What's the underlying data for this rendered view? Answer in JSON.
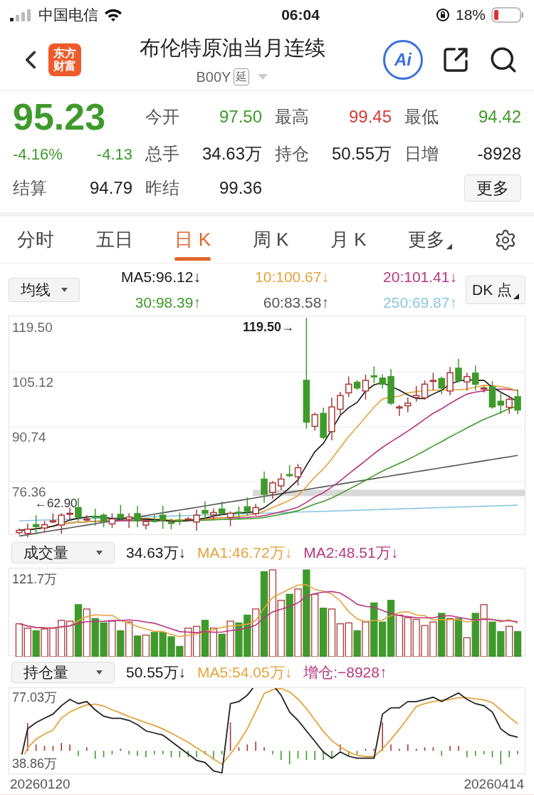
{
  "status_bar": {
    "carrier": "中国电信",
    "time": "06:04",
    "battery": "18%"
  },
  "header": {
    "logo": [
      "东方",
      "财富"
    ],
    "title": "布伦特原油当月连续",
    "code": "B00Y",
    "badge": "延",
    "ai": "Ai"
  },
  "quote": {
    "price": "95.23",
    "change_pct": "-4.16%",
    "change": "-4.13",
    "color": "#3f9a2c",
    "fields": [
      {
        "label": "今开",
        "value": "97.50",
        "color": "#3f9a2c"
      },
      {
        "label": "最高",
        "value": "99.45",
        "color": "#d43c3c"
      },
      {
        "label": "最低",
        "value": "94.42",
        "color": "#3f9a2c"
      },
      {
        "label": "总手",
        "value": "34.63万",
        "color": "#222222"
      },
      {
        "label": "持仓",
        "value": "50.55万",
        "color": "#222222"
      },
      {
        "label": "日增",
        "value": "-8928",
        "color": "#222222"
      },
      {
        "label": "昨结",
        "value": "99.36",
        "color": "#222222"
      }
    ],
    "settlement": {
      "label": "结算",
      "value": "94.79"
    },
    "more_button": "更多"
  },
  "tabs": [
    {
      "label": "分时",
      "selected": false,
      "dropdown": false
    },
    {
      "label": "五日",
      "selected": false,
      "dropdown": false
    },
    {
      "label": "日 K",
      "selected": true,
      "dropdown": false
    },
    {
      "label": "周 K",
      "selected": false,
      "dropdown": false
    },
    {
      "label": "月 K",
      "selected": false,
      "dropdown": false
    },
    {
      "label": "更多",
      "selected": false,
      "dropdown": true
    }
  ],
  "ma_bar": {
    "selector": "均线",
    "button": "DK 点",
    "readings": [
      {
        "text": "MA5:96.12↓",
        "color": "#1a1a1a"
      },
      {
        "text": "10:100.67↓",
        "color": "#e5a33d"
      },
      {
        "text": "20:101.41↓",
        "color": "#b8387e"
      },
      {
        "text": "30:98.39↑",
        "color": "#3f9a2c"
      },
      {
        "text": "60:83.58↑",
        "color": "#555555"
      },
      {
        "text": "250:69.87↑",
        "color": "#8cc6e2"
      }
    ]
  },
  "price_chart": {
    "yticks": [
      "119.50",
      "105.12",
      "90.74",
      "76.36"
    ],
    "high_label": "119.50→",
    "low_label": "←62.90"
  },
  "volume": {
    "selector": "成交量",
    "readings": [
      {
        "text": "34.63万↓",
        "color": "#1a1a1a"
      },
      {
        "text": "MA1:46.72万↓",
        "color": "#e5a33d"
      },
      {
        "text": "MA2:48.51万↓",
        "color": "#b8387e"
      }
    ],
    "ytick": "121.7万"
  },
  "open_interest": {
    "selector": "持仓量",
    "readings": [
      {
        "text": "50.55万↓",
        "color": "#1a1a1a"
      },
      {
        "text": "MA5:54.05万↓",
        "color": "#e5a33d"
      },
      {
        "text": "增仓:−8928↑",
        "color": "#b8387e"
      }
    ],
    "yticks": [
      "77.03万",
      "38.86万"
    ]
  },
  "dates": [
    "20260120",
    "20260414"
  ]
}
